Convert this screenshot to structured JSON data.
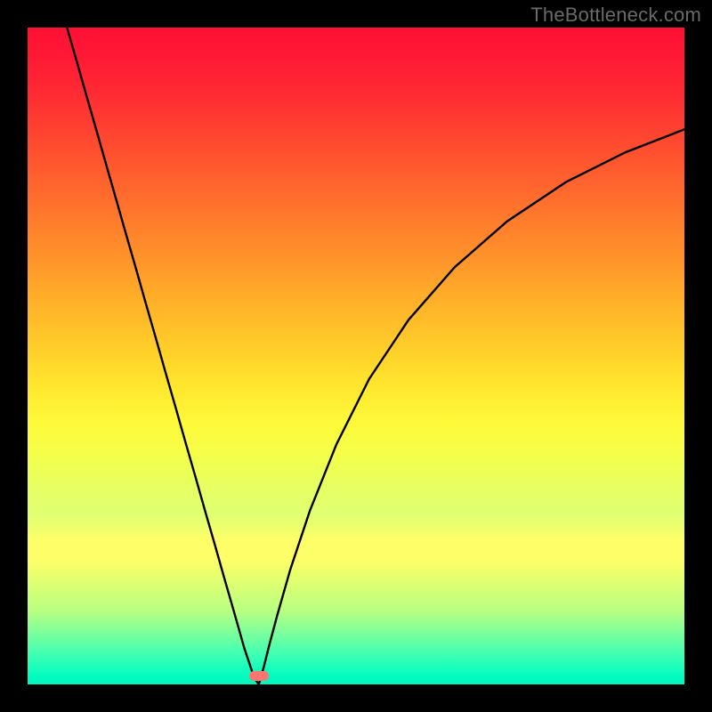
{
  "watermark": "TheBottleneck.com",
  "marker": {
    "x_frac": 0.352,
    "y_frac": 0.987
  },
  "colors": {
    "background": "#000000",
    "curve": "#000000",
    "marker": "#fc7772",
    "watermark": "#6a6a6a"
  },
  "chart_data": {
    "type": "line",
    "title": "",
    "xlabel": "",
    "ylabel": "",
    "xlim": [
      0,
      1
    ],
    "ylim": [
      0,
      1
    ],
    "x": [
      0.06,
      0.075,
      0.09,
      0.105,
      0.12,
      0.135,
      0.15,
      0.165,
      0.18,
      0.195,
      0.21,
      0.225,
      0.24,
      0.255,
      0.27,
      0.285,
      0.3,
      0.315,
      0.33,
      0.345,
      0.352,
      0.36,
      0.368,
      0.38,
      0.4,
      0.43,
      0.47,
      0.52,
      0.58,
      0.65,
      0.73,
      0.82,
      0.91,
      1.0
    ],
    "y": [
      1.0,
      0.948,
      0.895,
      0.843,
      0.79,
      0.738,
      0.685,
      0.633,
      0.58,
      0.528,
      0.475,
      0.423,
      0.37,
      0.318,
      0.265,
      0.213,
      0.16,
      0.108,
      0.055,
      0.01,
      0.0,
      0.028,
      0.06,
      0.105,
      0.175,
      0.265,
      0.365,
      0.465,
      0.555,
      0.635,
      0.705,
      0.765,
      0.81,
      0.845
    ],
    "annotations": []
  }
}
